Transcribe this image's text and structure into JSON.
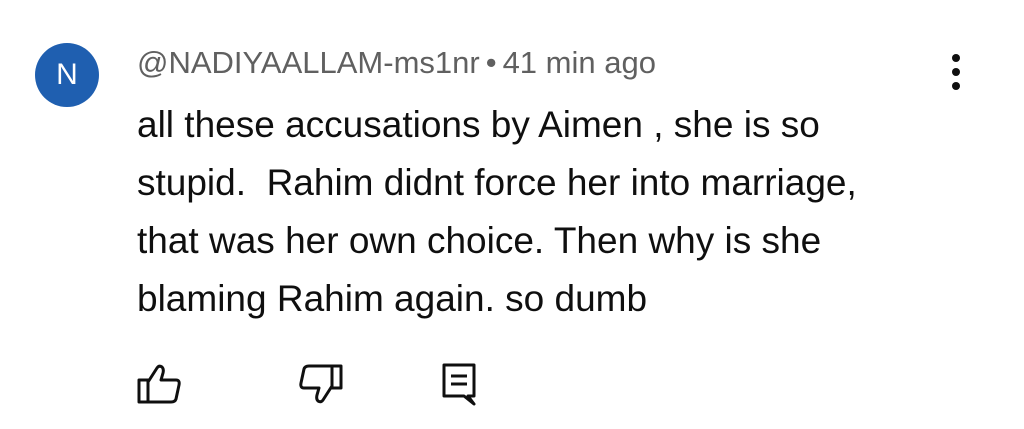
{
  "comment": {
    "avatar_letter": "N",
    "avatar_color": "#1f5fb0",
    "author": "@NADIYAALLAM-ms1nr",
    "separator": "•",
    "timestamp": "41 min ago",
    "text_lines": [
      "all these accusations by Aimen , she is so",
      "stupid.  Rahim didnt force her into marriage,",
      "that was her own choice. Then why is she",
      "blaming Rahim again. so dumb"
    ]
  },
  "actions": {
    "like_icon": "thumbs-up-icon",
    "dislike_icon": "thumbs-down-icon",
    "reply_icon": "reply-comment-icon",
    "more_icon": "more-vertical-icon"
  }
}
